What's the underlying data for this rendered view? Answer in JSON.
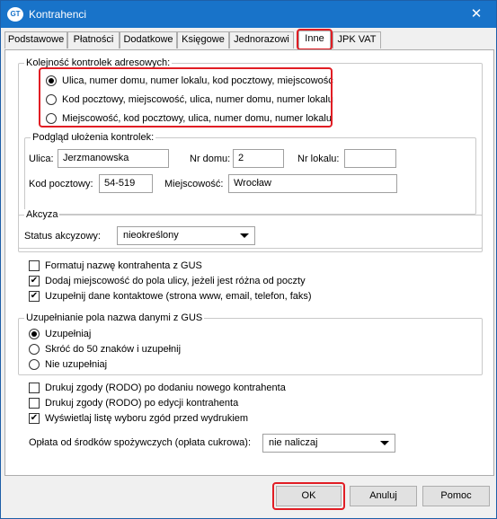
{
  "window": {
    "title": "Kontrahenci",
    "app_icon_text": "GT",
    "close_glyph": "✕"
  },
  "tabs": [
    "Podstawowe",
    "Płatności",
    "Dodatkowe",
    "Księgowe",
    "Jednorazowi",
    "Inne",
    "JPK VAT"
  ],
  "active_tab": "Inne",
  "address_order": {
    "label": "Kolejność kontrolek adresowych:",
    "options": [
      "Ulica, numer domu, numer lokalu, kod pocztowy, miejscowość",
      "Kod pocztowy, miejscowość, ulica, numer domu, numer lokalu",
      "Miejscowość, kod pocztowy, ulica, numer domu, numer lokalu"
    ],
    "selected_index": 0
  },
  "preview": {
    "label": "Podgląd ułożenia kontrolek:",
    "street_label": "Ulica:",
    "street_value": "Jerzmanowska",
    "house_label": "Nr domu:",
    "house_value": "2",
    "apartment_label": "Nr lokalu:",
    "apartment_value": "",
    "postal_label": "Kod pocztowy:",
    "postal_value": "54-519",
    "city_label": "Miejscowość:",
    "city_value": "Wrocław"
  },
  "excise": {
    "label": "Akcyza",
    "status_label": "Status akcyzowy:",
    "status_value": "nieokreślony"
  },
  "options": [
    {
      "label": "Formatuj nazwę kontrahenta z GUS",
      "checked": false
    },
    {
      "label": "Dodaj miejscowość do pola ulicy, jeżeli jest różna od poczty",
      "checked": true
    },
    {
      "label": "Uzupełnij dane kontaktowe (strona www, email, telefon, faks)",
      "checked": true
    }
  ],
  "gus_fill": {
    "label": "Uzupełnianie pola nazwa danymi z GUS",
    "options": [
      "Uzupełniaj",
      "Skróć do 50 znaków i uzupełnij",
      "Nie uzupełniaj"
    ],
    "selected_index": 0
  },
  "consents": [
    {
      "label": "Drukuj zgody (RODO) po dodaniu nowego kontrahenta",
      "checked": false
    },
    {
      "label": "Drukuj zgody (RODO) po edycji kontrahenta",
      "checked": false
    },
    {
      "label": "Wyświetlaj listę wyboru zgód przed wydrukiem",
      "checked": true
    }
  ],
  "sugar_fee": {
    "label": "Opłata od środków spożywczych (opłata cukrowa):",
    "value": "nie naliczaj"
  },
  "buttons": {
    "ok": "OK",
    "cancel": "Anuluj",
    "help": "Pomoc"
  },
  "colors": {
    "titlebar": "#1873c9",
    "highlight": "#e11d24"
  }
}
